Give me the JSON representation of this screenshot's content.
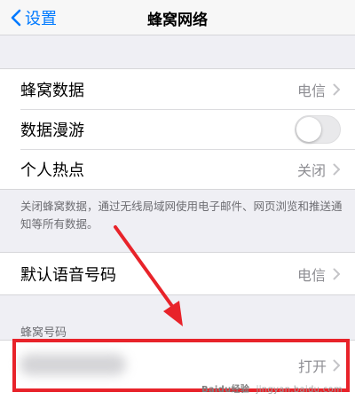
{
  "navbar": {
    "back_label": "设置",
    "title": "蜂窝网络"
  },
  "group1": {
    "rows": [
      {
        "label": "蜂窝数据",
        "value": "电信"
      },
      {
        "label": "数据漫游",
        "toggle_on": false
      },
      {
        "label": "个人热点",
        "value": "关闭"
      }
    ]
  },
  "footer_note": "关闭蜂窝数据，通过无线局域网使用电子邮件、网页浏览和推送通知等所有数据。",
  "group2": {
    "rows": [
      {
        "label": "默认语音号码",
        "value": "电信"
      }
    ]
  },
  "section_header": "蜂窝号码",
  "phone_row": {
    "value": "打开"
  },
  "watermark": {
    "logo": "Baidu经验",
    "url": "jingyan.baidu.com"
  },
  "colors": {
    "accent": "#007aff",
    "highlight": "#e8232a"
  },
  "icons": [
    "chevron-left-icon",
    "chevron-right-icon",
    "arrow-annotation"
  ]
}
